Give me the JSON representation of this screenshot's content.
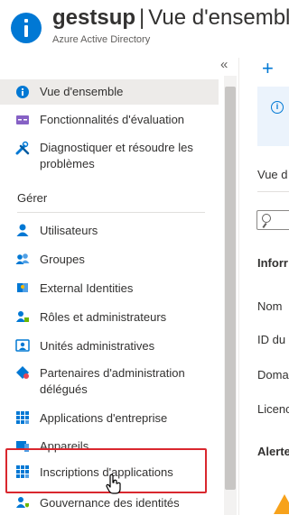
{
  "header": {
    "app_name": "gestsup",
    "separator": "|",
    "page_title": "Vue d'ensemble",
    "subtitle": "Azure Active Directory"
  },
  "sidebar": {
    "collapse_icon": "«",
    "items_top": [
      {
        "label": "Vue d'ensemble",
        "icon": "info-icon"
      },
      {
        "label": "Fonctionnalités d'évaluation",
        "icon": "preview-features-icon"
      },
      {
        "label": "Diagnostiquer et résoudre les problèmes",
        "icon": "wrench-icon"
      }
    ],
    "section_title": "Gérer",
    "items_manage": [
      {
        "label": "Utilisateurs",
        "icon": "user-icon"
      },
      {
        "label": "Groupes",
        "icon": "groups-icon"
      },
      {
        "label": "External Identities",
        "icon": "external-identities-icon"
      },
      {
        "label": "Rôles et administrateurs",
        "icon": "roles-icon"
      },
      {
        "label": "Unités administratives",
        "icon": "admin-units-icon"
      },
      {
        "label": "Partenaires d'administration délégués",
        "icon": "delegated-partners-icon"
      },
      {
        "label": "Applications d'entreprise",
        "icon": "enterprise-apps-icon"
      },
      {
        "label": "Appareils",
        "icon": "devices-icon"
      },
      {
        "label": "Inscriptions d'applications",
        "icon": "app-registrations-icon"
      },
      {
        "label": "Gouvernance des identités",
        "icon": "identity-governance-icon"
      }
    ]
  },
  "right_panel": {
    "add_icon": "+",
    "banner_icon": "i",
    "tab_label": "Vue d",
    "section_label": "Inforr",
    "fields": [
      "Nom",
      "ID du",
      "Doma",
      "Licenc"
    ],
    "alerts_label": "Alerte"
  },
  "colors": {
    "accent": "#0078d4",
    "selected_bg": "#edebe9",
    "highlight": "#d9272e",
    "warning": "#f7a21b"
  }
}
